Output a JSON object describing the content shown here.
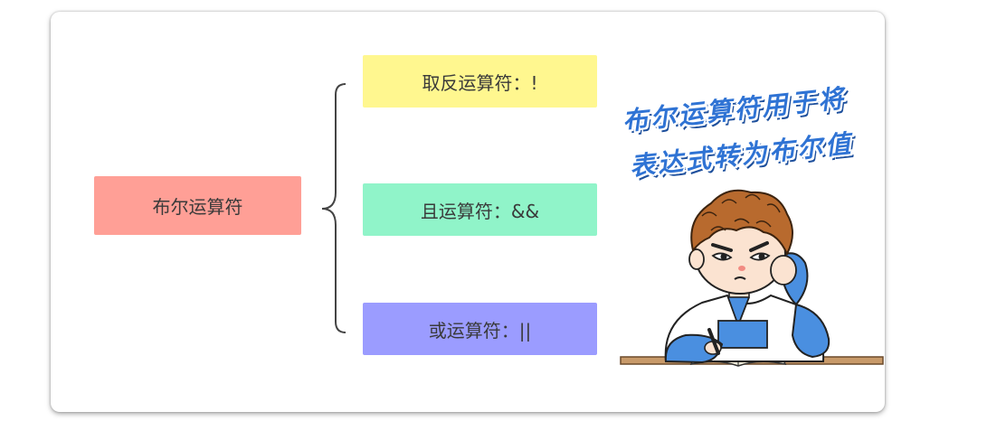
{
  "diagram": {
    "root": {
      "label": "布尔运算符",
      "color": "#ff9f96"
    },
    "children": [
      {
        "label": "取反运算符：!",
        "color": "#fff78f"
      },
      {
        "label": "且运算符：&&",
        "color": "#90f4c9"
      },
      {
        "label": "或运算符：||",
        "color": "#9b9cff"
      }
    ]
  },
  "caption": {
    "line1": "布尔运算符用于将",
    "line2": "表达式转为布尔值",
    "color": "#2f73d4"
  },
  "illustration": {
    "subject": "student-thinking-illustration"
  }
}
